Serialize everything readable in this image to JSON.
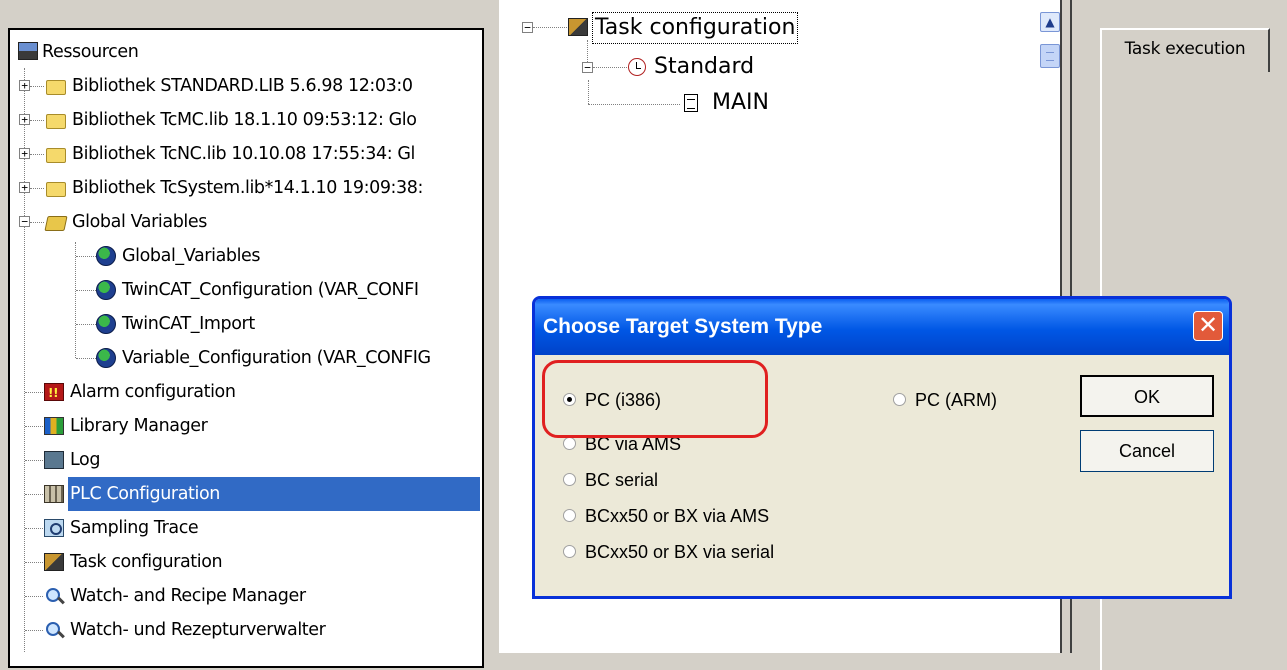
{
  "left_tree": {
    "root_label": "Ressourcen",
    "items": [
      {
        "label": "Bibliothek STANDARD.LIB 5.6.98 12:03:0"
      },
      {
        "label": "Bibliothek TcMC.lib 18.1.10 09:53:12: Glo"
      },
      {
        "label": "Bibliothek TcNC.lib 10.10.08 17:55:34: Gl"
      },
      {
        "label": "Bibliothek TcSystem.lib*14.1.10 19:09:38:"
      },
      {
        "label": "Global Variables"
      },
      {
        "label": "Global_Variables"
      },
      {
        "label": "TwinCAT_Configuration (VAR_CONFI"
      },
      {
        "label": "TwinCAT_Import"
      },
      {
        "label": "Variable_Configuration (VAR_CONFIG"
      },
      {
        "label": "Alarm configuration"
      },
      {
        "label": "Library Manager"
      },
      {
        "label": "Log"
      },
      {
        "label": "PLC Configuration"
      },
      {
        "label": "Sampling Trace"
      },
      {
        "label": "Task configuration"
      },
      {
        "label": "Watch- and Recipe Manager"
      },
      {
        "label": "Watch- und Rezepturverwalter"
      }
    ],
    "selected": "PLC Configuration"
  },
  "task_tree": {
    "root_label": "Task configuration",
    "task_label": "Standard",
    "program_label": "MAIN"
  },
  "right_panel": {
    "tab_label": "Task execution"
  },
  "dialog": {
    "title": "Choose Target System Type",
    "close_symbol": "✕",
    "options": [
      {
        "label": "PC (i386)",
        "checked": true
      },
      {
        "label": "BC via AMS",
        "checked": false
      },
      {
        "label": "BC serial",
        "checked": false
      },
      {
        "label": "BCxx50 or BX via AMS",
        "checked": false
      },
      {
        "label": "BCxx50 or BX via serial",
        "checked": false
      },
      {
        "label": "PC (ARM)",
        "checked": false
      }
    ],
    "ok_label": "OK",
    "cancel_label": "Cancel"
  },
  "colors": {
    "selection": "#316ac5",
    "dialog_title": "#0057e5",
    "highlight": "#e02020"
  }
}
